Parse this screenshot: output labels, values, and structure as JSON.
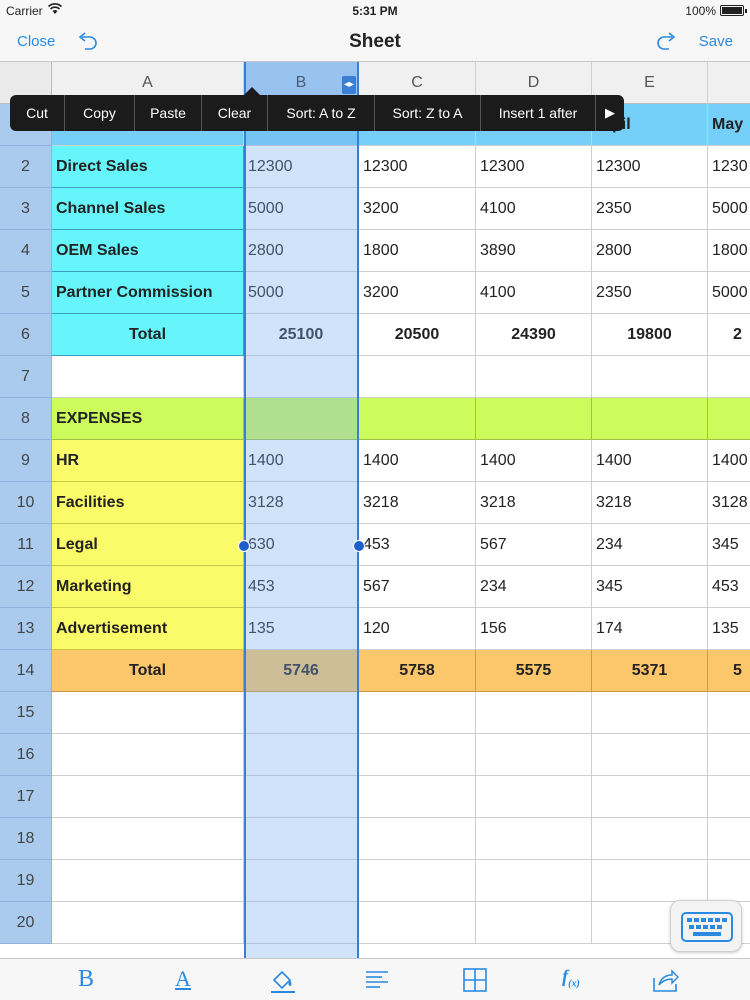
{
  "status": {
    "carrier": "Carrier",
    "time": "5:31 PM",
    "battery": "100%"
  },
  "nav": {
    "close": "Close",
    "title": "Sheet",
    "save": "Save"
  },
  "columns": [
    "A",
    "B",
    "C",
    "D",
    "E"
  ],
  "menu": [
    "Cut",
    "Copy",
    "Paste",
    "Clear",
    "Sort: A to Z",
    "Sort: Z to A",
    "Insert 1 after"
  ],
  "header_row_visible": {
    "E": "pil",
    "F": "May"
  },
  "rows": [
    {
      "n": "2",
      "label": "Direct Sales",
      "v": [
        "12300",
        "12300",
        "12300",
        "12300",
        "1230"
      ]
    },
    {
      "n": "3",
      "label": "Channel Sales",
      "v": [
        "5000",
        "3200",
        "4100",
        "2350",
        "5000"
      ]
    },
    {
      "n": "4",
      "label": "OEM Sales",
      "v": [
        "2800",
        "1800",
        "3890",
        "2800",
        "1800"
      ]
    },
    {
      "n": "5",
      "label": "Partner Commission",
      "v": [
        "5000",
        "3200",
        "4100",
        "2350",
        "5000"
      ]
    },
    {
      "n": "6",
      "label": "Total",
      "v": [
        "25100",
        "20500",
        "24390",
        "19800",
        "2"
      ]
    },
    {
      "n": "7",
      "label": "",
      "v": [
        "",
        "",
        "",
        "",
        ""
      ]
    },
    {
      "n": "8",
      "label": "EXPENSES",
      "v": [
        "",
        "",
        "",
        "",
        ""
      ]
    },
    {
      "n": "9",
      "label": "HR",
      "v": [
        "1400",
        "1400",
        "1400",
        "1400",
        "1400"
      ]
    },
    {
      "n": "10",
      "label": "Facilities",
      "v": [
        "3128",
        "3218",
        "3218",
        "3218",
        "3128"
      ]
    },
    {
      "n": "11",
      "label": "Legal",
      "v": [
        "630",
        "453",
        "567",
        "234",
        "345"
      ]
    },
    {
      "n": "12",
      "label": "Marketing",
      "v": [
        "453",
        "567",
        "234",
        "345",
        "453"
      ]
    },
    {
      "n": "13",
      "label": "Advertisement",
      "v": [
        "135",
        "120",
        "156",
        "174",
        "135"
      ]
    },
    {
      "n": "14",
      "label": "Total",
      "v": [
        "5746",
        "5758",
        "5575",
        "5371",
        "5"
      ]
    },
    {
      "n": "15",
      "label": "",
      "v": [
        "",
        "",
        "",
        "",
        ""
      ]
    },
    {
      "n": "16",
      "label": "",
      "v": [
        "",
        "",
        "",
        "",
        ""
      ]
    },
    {
      "n": "17",
      "label": "",
      "v": [
        "",
        "",
        "",
        "",
        ""
      ]
    },
    {
      "n": "18",
      "label": "",
      "v": [
        "",
        "",
        "",
        "",
        ""
      ]
    },
    {
      "n": "19",
      "label": "",
      "v": [
        "",
        "",
        "",
        "",
        ""
      ]
    },
    {
      "n": "20",
      "label": "",
      "v": [
        "",
        "",
        "",
        "",
        ""
      ]
    }
  ],
  "toolbar_icons": [
    "bold-icon",
    "font-color-icon",
    "fill-color-icon",
    "align-icon",
    "borders-icon",
    "function-icon",
    "share-icon"
  ],
  "colors": {
    "accent": "#2a8ae0",
    "income_label": "#66f5fb",
    "income_header": "#75cff8",
    "expenses": "#ccfb5c",
    "expense_label": "#fbfb6a",
    "expense_total": "#fcc66b",
    "selection": "#3a7fd4"
  }
}
